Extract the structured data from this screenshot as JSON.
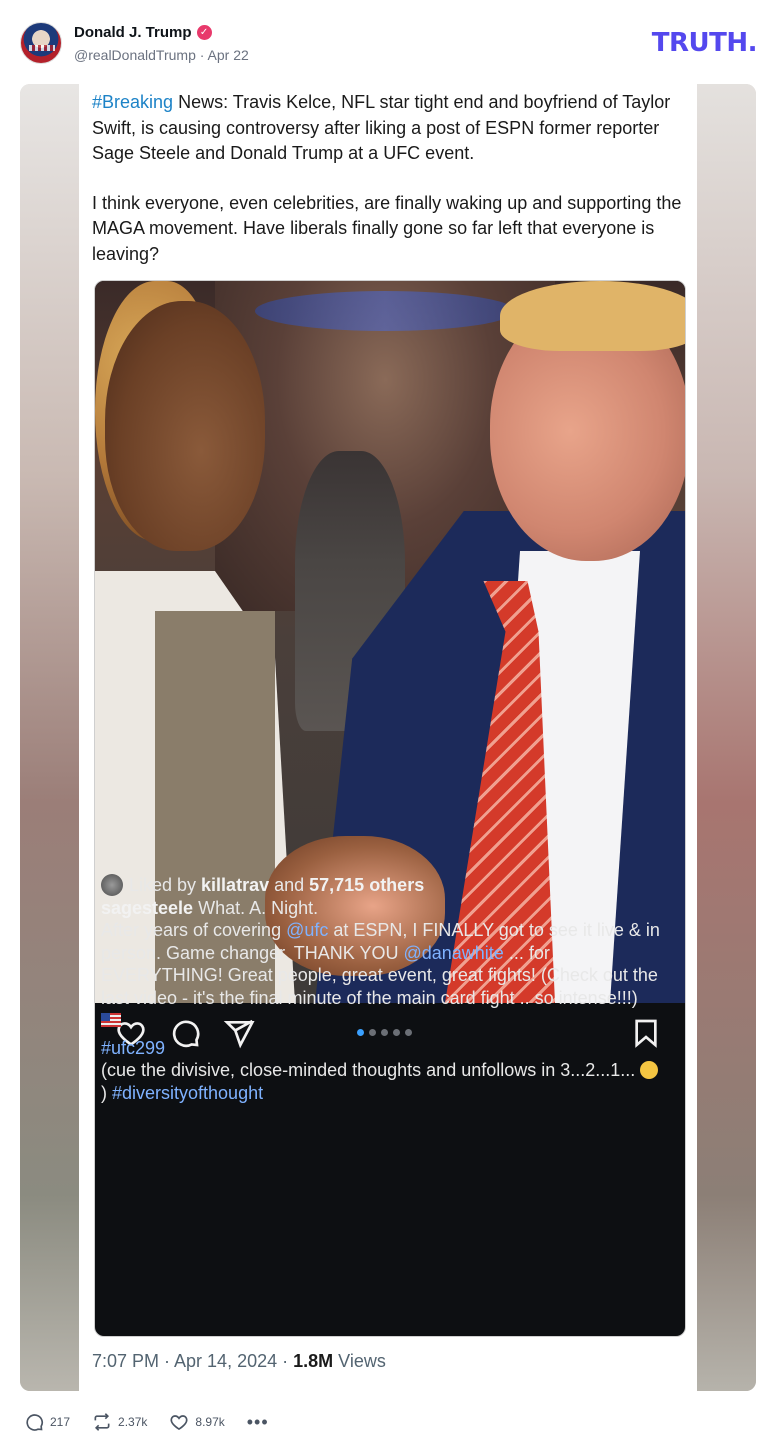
{
  "header": {
    "display_name": "Donald J. Trump",
    "verified_glyph": "✓",
    "handle": "@realDonaldTrump",
    "separator": "·",
    "date": "Apr 22",
    "logo": "TRUTH."
  },
  "tweet": {
    "hashtag": "#Breaking",
    "para1_rest": " News:  Travis Kelce, NFL star tight end and boyfriend of Taylor Swift, is causing controversy after liking a post of ESPN former reporter Sage Steele and Donald Trump at a UFC event.",
    "para2": "I think everyone, even celebrities, are finally waking up and supporting the MAGA movement.  Have liberals finally gone so far left that everyone is leaving?",
    "time": "7:07 PM · Apr 14, 2024 · ",
    "views_count": "1.8M",
    "views_label": " Views"
  },
  "instagram": {
    "liked_prefix": "Liked by ",
    "liked_user": "killatrav",
    "liked_mid": " and ",
    "liked_others": "57,715 others",
    "caption_user": "sagesteele",
    "caption_first": " What.  A.  Night.",
    "caption_a": "After years of covering ",
    "mention_ufc": "@ufc",
    "caption_b": " at ESPN, I FINALLY got to see it live & in person.  Game changer.  THANK YOU ",
    "mention_dana": "@danawhite",
    "caption_c": " ... for EVERYTHING!  Great people, great event, great fights! (Check out the last video - it's the final minute of the main card fight .. so intense!!!)",
    "tag_ufc299": "#ufc299",
    "caption_d": "(cue the divisive, close-minded thoughts and unfollows in 3...2...1... ",
    "caption_e": ") ",
    "tag_diversity": "#diversityofthought",
    "carousel_total": 5,
    "carousel_active": 1
  },
  "footer": {
    "replies": "217",
    "retruths": "2.37k",
    "likes": "8.97k",
    "more": "•••"
  },
  "colors": {
    "brand": "#5448ee",
    "verified": "#e8396b",
    "hashtag": "#1d83c7",
    "insta_bg": "#0d0f12",
    "insta_link": "#7fb2ff"
  },
  "icons": [
    "verified-badge-icon",
    "heart-icon",
    "comment-icon",
    "share-icon",
    "bookmark-icon",
    "reply-icon",
    "retruth-icon",
    "like-icon",
    "more-icon"
  ]
}
